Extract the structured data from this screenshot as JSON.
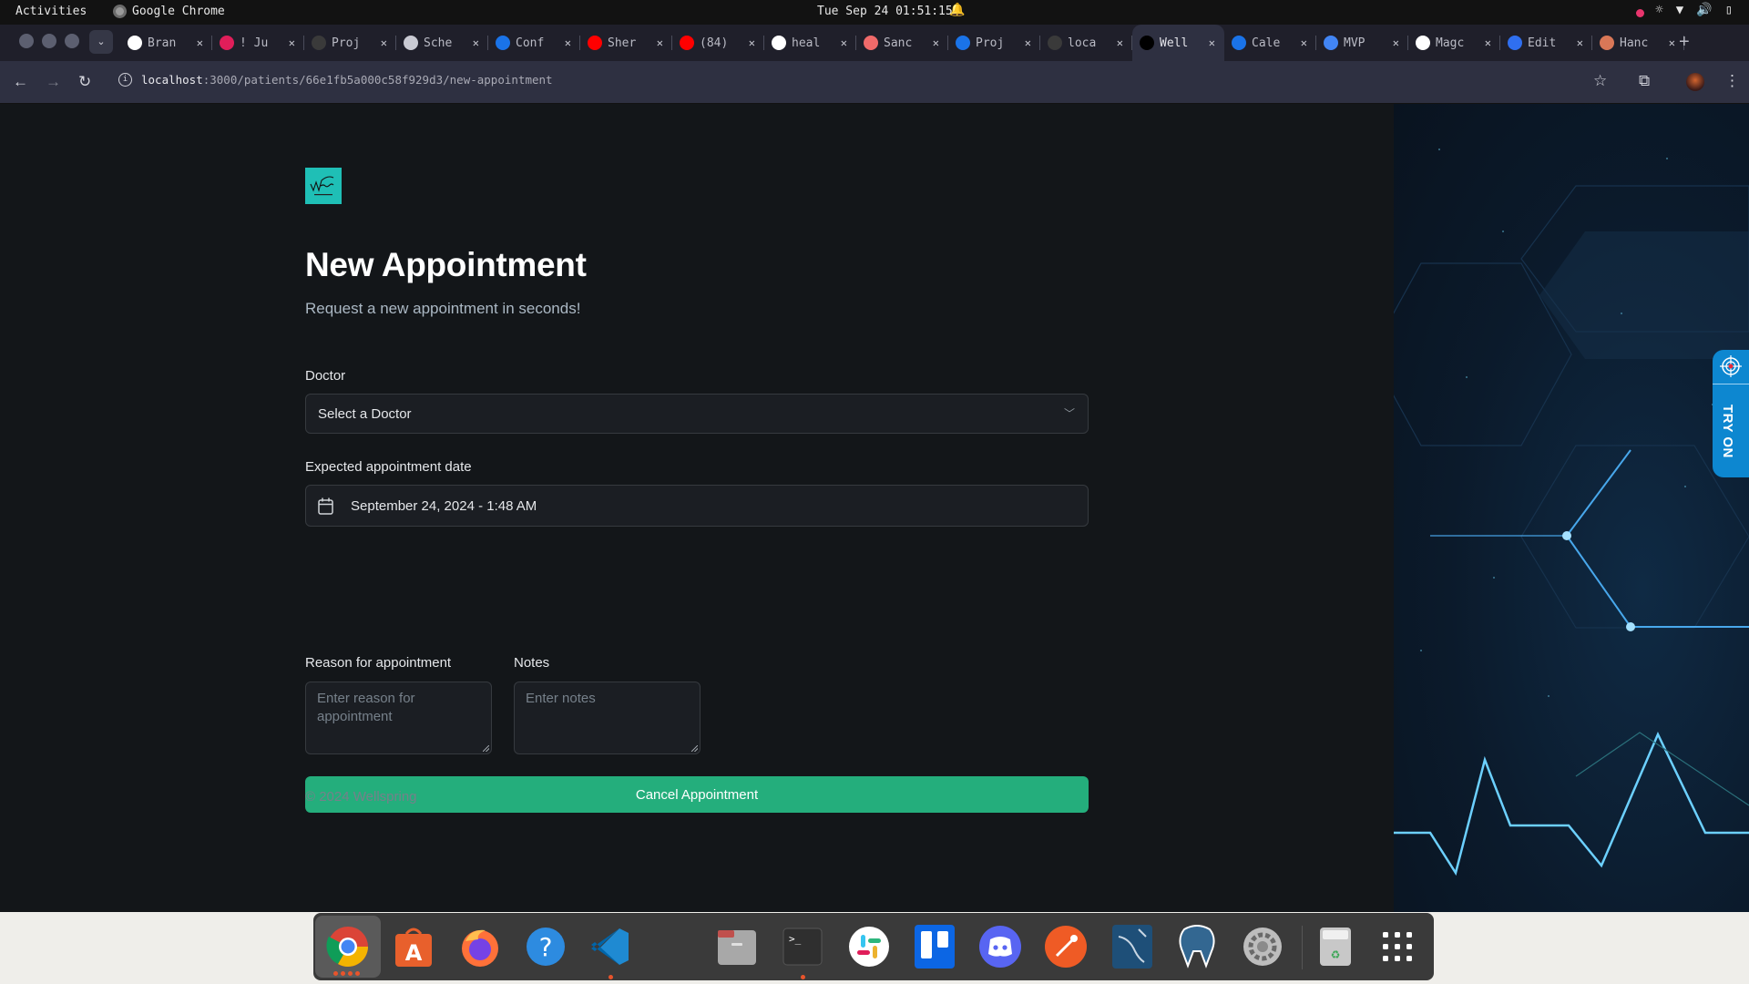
{
  "system_bar": {
    "activities": "Activities",
    "app_name": "Google Chrome",
    "clock": "Tue Sep 24  01:51:15"
  },
  "browser": {
    "tabs": [
      {
        "title": "Bran",
        "icon": "github-icon",
        "color": "#ffffff"
      },
      {
        "title": "! Ju",
        "icon": "slack-icon",
        "color": "#e01e5a"
      },
      {
        "title": "Proj",
        "icon": "qix-icon",
        "color": "#3a3a3a"
      },
      {
        "title": "Sche",
        "icon": "globe-icon",
        "color": "#c9cad3"
      },
      {
        "title": "Conf",
        "icon": "calendly-icon",
        "color": "#1a73e8"
      },
      {
        "title": "Sher",
        "icon": "youtube-icon",
        "color": "#ff0000"
      },
      {
        "title": "(84)",
        "icon": "youtube-icon",
        "color": "#ff0000"
      },
      {
        "title": "heal",
        "icon": "github-icon",
        "color": "#ffffff"
      },
      {
        "title": "Sanc",
        "icon": "asana-icon",
        "color": "#f06a6a"
      },
      {
        "title": "Proj",
        "icon": "w3c-icon",
        "color": "#1a73e8"
      },
      {
        "title": "loca",
        "icon": "vercel-icon",
        "color": "#3a3a3a"
      },
      {
        "title": "Well",
        "icon": "vercel-icon",
        "color": "#000000",
        "active": true
      },
      {
        "title": "Cale",
        "icon": "calendly-icon",
        "color": "#1a73e8"
      },
      {
        "title": "MVP",
        "icon": "docs-icon",
        "color": "#4285f4"
      },
      {
        "title": "Magc",
        "icon": "github-icon",
        "color": "#ffffff"
      },
      {
        "title": "Edit",
        "icon": "diamond-icon",
        "color": "#2f6ff0"
      },
      {
        "title": "Hanc",
        "icon": "claude-icon",
        "color": "#d97757"
      }
    ],
    "url_host": "localhost",
    "url_path": ":3000/patients/66e1fb5a000c58f929d3/new-appointment"
  },
  "page": {
    "logo_alt": "Wellspring",
    "title": "New Appointment",
    "subtitle": "Request a new appointment in seconds!",
    "doctor": {
      "label": "Doctor",
      "placeholder": "Select a Doctor"
    },
    "date": {
      "label": "Expected appointment date",
      "value": "September 24, 2024 - 1:48 AM"
    },
    "reason": {
      "label": "Reason for appointment",
      "placeholder": "Enter reason for appointment"
    },
    "notes": {
      "label": "Notes",
      "placeholder": "Enter notes"
    },
    "submit_label": "Cancel Appointment",
    "footer": "© 2024 Wellspring",
    "accent_color": "#24ae7c"
  },
  "widget": {
    "label": "TRY ON"
  },
  "dock": {
    "apps": [
      "chrome",
      "app-center",
      "firefox",
      "help",
      "vscode",
      "files",
      "terminal",
      "slack",
      "trello",
      "discord",
      "postman",
      "mysql-workbench",
      "pgadmin",
      "settings",
      "trash",
      "show-apps"
    ]
  }
}
